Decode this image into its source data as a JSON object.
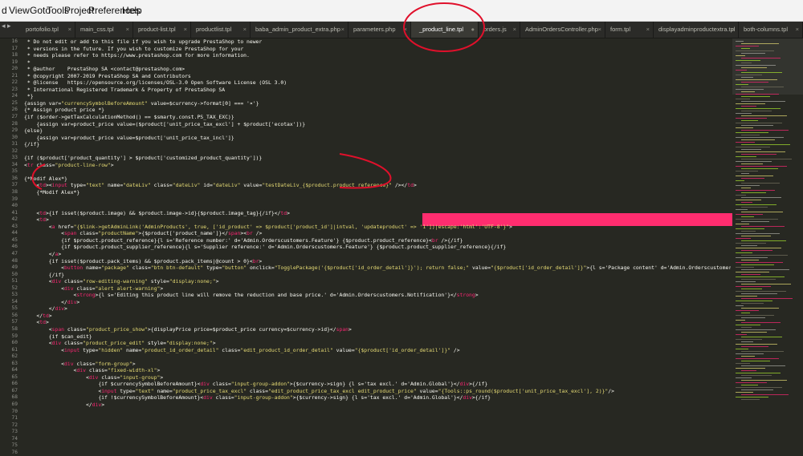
{
  "menu": [
    "d",
    "View",
    "Goto",
    "Tools",
    "Project",
    "Preferences",
    "Help"
  ],
  "tab_arrows": "◂ ▸",
  "tabs": [
    {
      "label": "portofolio.tpl",
      "active": false
    },
    {
      "label": "main_css.tpl",
      "active": false
    },
    {
      "label": "product-list.tpl",
      "active": false
    },
    {
      "label": "productlist.tpl",
      "active": false
    },
    {
      "label": "baba_admin_product_extra.php",
      "active": false
    },
    {
      "label": "parameters.php",
      "active": false
    },
    {
      "label": "_product_line.tpl",
      "active": true
    },
    {
      "label": "orders.js",
      "active": false
    },
    {
      "label": "AdminOrdersController.php",
      "active": false
    },
    {
      "label": "form.tpl",
      "active": false
    },
    {
      "label": "displayadminproductextra.tpl",
      "active": false
    },
    {
      "label": "both-columns.tpl",
      "active": false
    }
  ],
  "tab_close": "×",
  "tab_dot": "●",
  "line_numbers": [
    "16",
    "17",
    "18",
    "19",
    "20",
    "21",
    "22",
    "23",
    "24",
    "25",
    "26",
    "27",
    "28",
    "29",
    "30",
    "31",
    "32",
    "33",
    "34",
    "35",
    "36",
    "37",
    "38",
    "39",
    "40",
    "41",
    "42",
    "43",
    "44",
    "45",
    "46",
    "47",
    "48",
    "49",
    "50",
    "51",
    "52",
    "53",
    "54",
    "55",
    "56",
    "57",
    "58",
    "59",
    "60",
    "61",
    "62",
    "63",
    "64",
    "65",
    "66",
    "67",
    "68",
    "69",
    "70",
    "71",
    "72",
    "73",
    "74",
    "75",
    "76"
  ],
  "code_lines": [
    " * Do not edit or add to this file if you wish to upgrade PrestaShop to newer",
    " * versions in the future. If you wish to customize PrestaShop for your",
    " * needs please refer to https://www.prestashop.com for more information.",
    " *",
    " * @author    PrestaShop SA <contact@prestashop.com>",
    " * @copyright 2007-2019 PrestaShop SA and Contributors",
    " * @license   https://opensource.org/licenses/OSL-3.0 Open Software License (OSL 3.0)",
    " * International Registered Trademark & Property of PrestaShop SA",
    " *}",
    "{assign var=\"currencySymbolBeforeAmount\" value=$currency->format[0] === '¤'}",
    "{* Assign product price *}",
    "{if ($order->getTaxCalculationMethod() == $smarty.const.PS_TAX_EXC)}",
    "    {assign var=product_price value=($product['unit_price_tax_excl'] + $product['ecotax'])}",
    "{else}",
    "    {assign var=product_price value=$product['unit_price_tax_incl']}",
    "{/if}",
    "",
    "{if ($product['product_quantity'] > $product['customized_product_quantity'])}",
    "<tr class=\"product-line-row\">",
    "",
    "{*Modif Alex*}",
    "    <td><input type=\"text\" name=\"dateLiv\" class=\"dateLiv\" id=\"dateLiv\" value=\"testDateLiv_{$product.product_reference}\" /></td>",
    "    {*Modif Alex*}",
    "",
    "",
    "    <td>{if isset($product.image) && $product.image->id}{$product.image_tag}{/if}</td>",
    "    <td>",
    "        <a href=\"{$link->getAdminLink('AdminProducts', true, ['id_product' => $product['product_id']|intval, 'updateproduct' => '1'])|escape:'html':'UTF-8'}\">",
    "            <span class=\"productName\">{$product['product_name']}</span><br />",
    "            {if $product.product_reference}{l s='Reference number:' d='Admin.Orderscustomers.Feature'} {$product.product_reference}<br />{/if}",
    "            {if $product.product_supplier_reference}{l s='Supplier reference:' d='Admin.Orderscustomers.Feature'} {$product.product_supplier_reference}{/if}",
    "        </a>",
    "        {if isset($product.pack_items) && $product.pack_items|@count > 0}<br>",
    "            <button name=\"package\" class=\"btn btn-default\" type=\"button\" onclick=\"TogglePackage('{$product['id_order_detail']}'); return false;\" value=\"{$product['id_order_detail']}\">{l s='Package content' d='Admin.Orderscustomers.Feature'}</button>",
    "        {/if}",
    "        <div class=\"row-editing-warning\" style=\"display:none;\">",
    "            <div class=\"alert alert-warning\">",
    "                <strong>{l s='Editing this product line will remove the reduction and base price.' d='Admin.Orderscustomers.Notification'}</strong>",
    "            </div>",
    "        </div>",
    "    </td>",
    "    <td>",
    "        <span class=\"product_price_show\">{displayPrice price=$product_price currency=$currency->id}</span>",
    "        {if $can_edit}",
    "        <div class=\"product_price_edit\" style=\"display:none;\">",
    "            <input type=\"hidden\" name=\"product_id_order_detail\" class=\"edit_product_id_order_detail\" value=\"{$product['id_order_detail']}\" />",
    "",
    "            <div class=\"form-group\">",
    "                <div class=\"fixed-width-xl\">",
    "                    <div class=\"input-group\">",
    "                        {if $currencySymbolBeforeAmount}<div class=\"input-group-addon\">{$currency->sign} {l s='tax excl.' d='Admin.Global'}</div>{/if}",
    "                        <input type=\"text\" name=\"product_price_tax_excl\" class=\"edit_product_price_tax_excl edit_product_price\" value=\"{Tools::ps_round($product['unit_price_tax_excl'], 2)}\"/>",
    "                        {if !$currencySymbolBeforeAmount}<div class=\"input-group-addon\">{$currency->sign} {l s='tax excl.' d='Admin.Global'}</div>{/if}",
    "                    </div>",
    "                </div>",
    "                <br/>",
    "                <div class=\"fixed-width-xl\">",
    "                    <div class=\"input-group\">",
    "                        {if $currencySymbolBeforeAmount}<div class=\"input-group-addon\">{$currency->sign} {l s='tax incl.' d='Admin.Global'}</div>{/if}",
    "                        <input type=\"text\" name=\"product_price_tax_incl\" class=\"edit_product_price_tax_incl edit_product_price\" value=\"{Tools::ps_round($product['unit_price_tax_incl'], 2)}\"/>",
    "                        {if !$currencySymbolBeforeAmount}<div class=\"input-group-addon\">{$currency->sign} {l s='tax incl.' d='Admin.Global'}</div>{/if}"
  ]
}
